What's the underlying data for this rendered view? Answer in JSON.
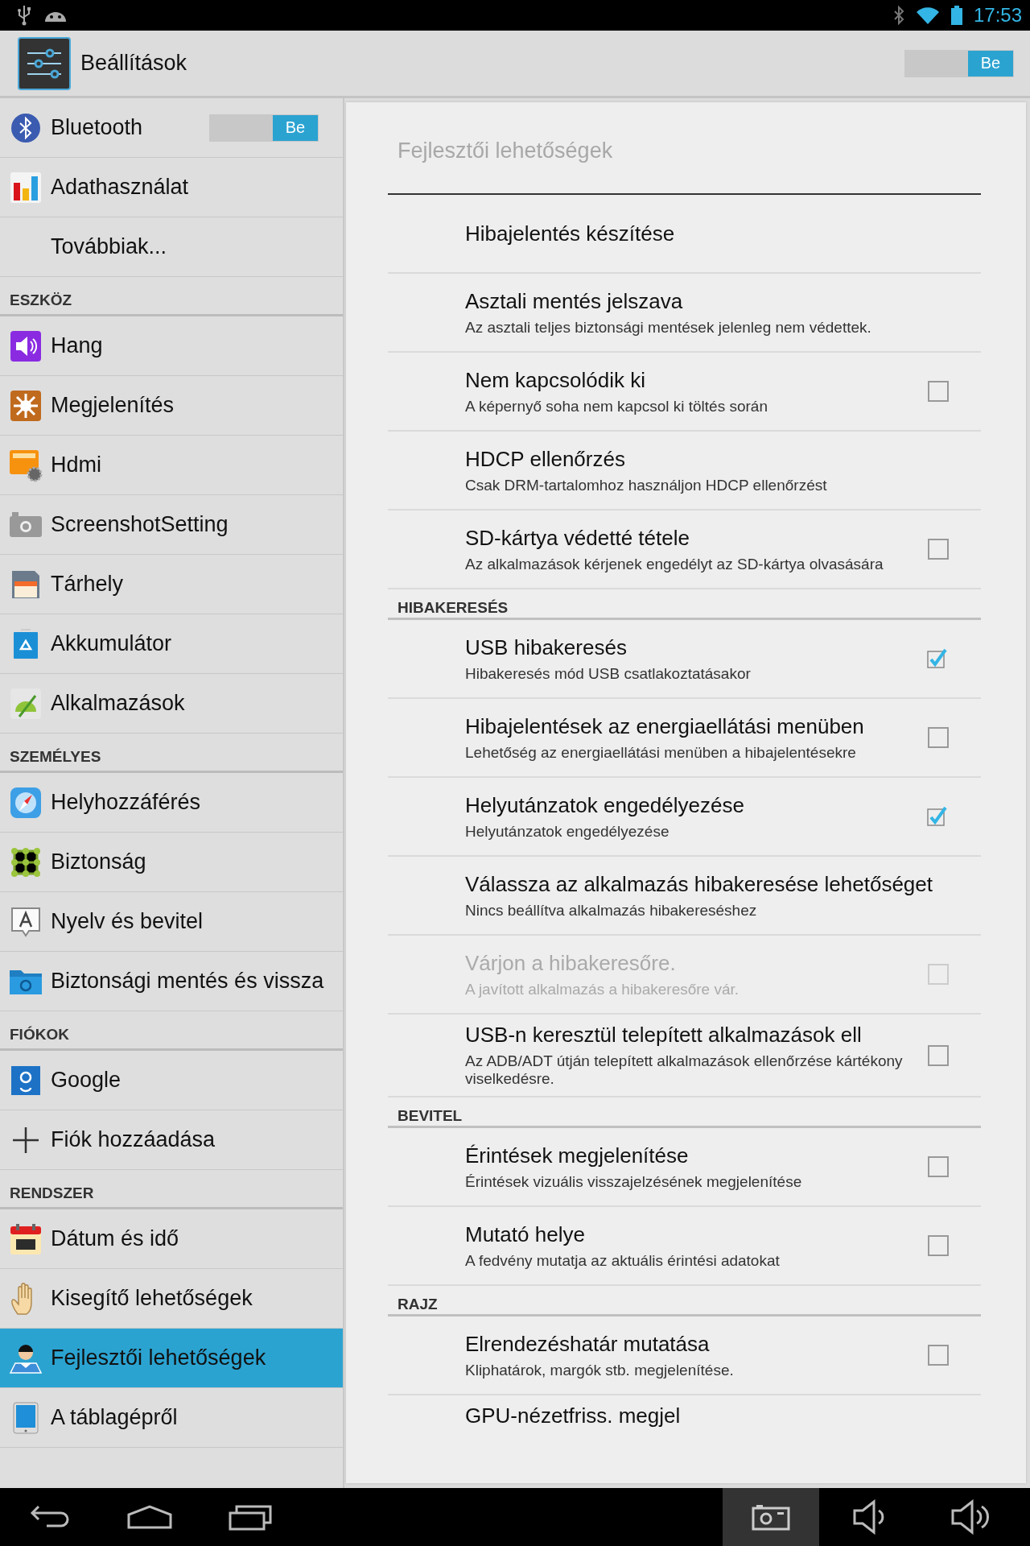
{
  "status_bar": {
    "time": "17:53"
  },
  "action_bar": {
    "title": "Beállítások",
    "switch": {
      "label": "Be",
      "on": true
    }
  },
  "sidebar": {
    "sections": [
      {
        "items": [
          {
            "label": "Bluetooth",
            "selected": false,
            "switch": {
              "label": "Be",
              "on": true
            }
          },
          {
            "label": "Adathasználat",
            "selected": false
          },
          {
            "label": "Továbbiak...",
            "selected": false
          }
        ]
      },
      {
        "header": "ESZKÖZ",
        "items": [
          {
            "label": "Hang",
            "selected": false
          },
          {
            "label": "Megjelenítés",
            "selected": false
          },
          {
            "label": "Hdmi",
            "selected": false
          },
          {
            "label": "ScreenshotSetting",
            "selected": false
          },
          {
            "label": "Tárhely",
            "selected": false
          },
          {
            "label": "Akkumulátor",
            "selected": false
          },
          {
            "label": "Alkalmazások",
            "selected": false
          }
        ]
      },
      {
        "header": "SZEMÉLYES",
        "items": [
          {
            "label": "Helyhozzáférés",
            "selected": false
          },
          {
            "label": "Biztonság",
            "selected": false
          },
          {
            "label": "Nyelv és bevitel",
            "selected": false
          },
          {
            "label": "Biztonsági mentés és vissza",
            "selected": false
          }
        ]
      },
      {
        "header": "FIÓKOK",
        "items": [
          {
            "label": "Google",
            "selected": false
          },
          {
            "label": "Fiók hozzáadása",
            "selected": false
          }
        ]
      },
      {
        "header": "RENDSZER",
        "items": [
          {
            "label": "Dátum és idő",
            "selected": false
          },
          {
            "label": "Kisegítő lehetőségek",
            "selected": false
          },
          {
            "label": "Fejlesztői lehetőségek",
            "selected": true
          },
          {
            "label": "A táblagépről",
            "selected": false
          }
        ]
      }
    ]
  },
  "panel": {
    "title": "Fejlesztői lehetőségek",
    "sections": [
      {
        "items": [
          {
            "kind": "plain",
            "title": "Hibajelentés készítése",
            "disabled": false
          },
          {
            "kind": "plain",
            "title": "Asztali mentés jelszava",
            "summary": "Az asztali teljes biztonsági mentések jelenleg nem védettek.",
            "disabled": false
          },
          {
            "kind": "checkbox",
            "title": "Nem kapcsolódik ki",
            "summary": "A képernyő soha nem kapcsol ki töltés során",
            "checked": false,
            "disabled": false
          },
          {
            "kind": "plain",
            "title": "HDCP ellenőrzés",
            "summary": "Csak DRM-tartalomhoz használjon HDCP ellenőrzést",
            "disabled": false
          },
          {
            "kind": "checkbox",
            "title": "SD-kártya védetté tétele",
            "summary": "Az alkalmazások kérjenek engedélyt az SD-kártya olvasására",
            "checked": false,
            "disabled": false
          }
        ]
      },
      {
        "header": "HIBAKERESÉS",
        "items": [
          {
            "kind": "checkbox",
            "title": "USB hibakeresés",
            "summary": "Hibakeresés mód USB csatlakoztatásakor",
            "checked": true,
            "disabled": false
          },
          {
            "kind": "checkbox",
            "title": "Hibajelentések az energiaellátási menüben",
            "summary": "Lehetőség az energiaellátási menüben a hibajelentésekre",
            "checked": false,
            "disabled": false
          },
          {
            "kind": "checkbox",
            "title": "Helyutánzatok engedélyezése",
            "summary": "Helyutánzatok engedélyezése",
            "checked": true,
            "disabled": false
          },
          {
            "kind": "plain",
            "title": "Válassza az alkalmazás hibakeresése lehetőséget",
            "summary": "Nincs beállítva alkalmazás hibakereséshez",
            "disabled": false
          },
          {
            "kind": "checkbox",
            "title": "Várjon a hibakeresőre.",
            "summary": "A javított alkalmazás a hibakeresőre vár.",
            "checked": false,
            "disabled": true
          },
          {
            "kind": "checkbox",
            "title": "USB-n keresztül telepített alkalmazások ell",
            "summary": "Az ADB/ADT útján telepített alkalmazások ellenőrzése kártékony viselkedésre.",
            "checked": false,
            "disabled": false
          }
        ]
      },
      {
        "header": "BEVITEL",
        "items": [
          {
            "kind": "checkbox",
            "title": "Érintések megjelenítése",
            "summary": "Érintések vizuális visszajelzésének megjelenítése",
            "checked": false,
            "disabled": false
          },
          {
            "kind": "checkbox",
            "title": "Mutató helye",
            "summary": "A fedvény mutatja az aktuális érintési adatokat",
            "checked": false,
            "disabled": false
          }
        ]
      },
      {
        "header": "RAJZ",
        "items": [
          {
            "kind": "checkbox",
            "title": "Elrendezéshatár mutatása",
            "summary": "Kliphatárok, margók stb. megjelenítése.",
            "checked": false,
            "disabled": false
          },
          {
            "kind": "plain",
            "title": "GPU-nézetfriss. megjel",
            "disabled": false
          }
        ]
      }
    ]
  }
}
